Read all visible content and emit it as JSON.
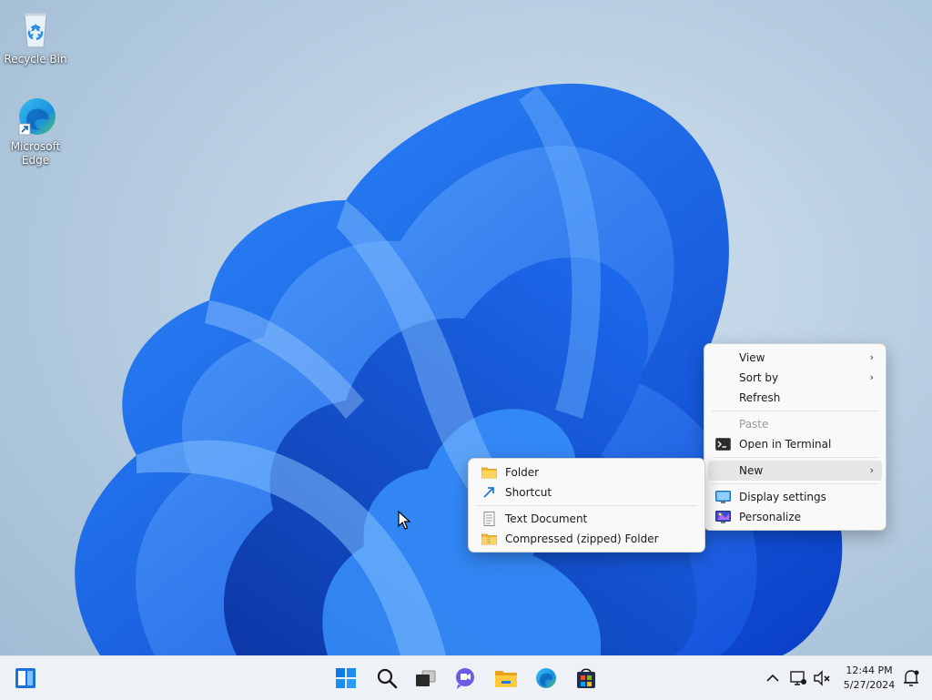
{
  "desktop": {
    "icons": [
      {
        "label": "Recycle Bin",
        "icon": "recycle-bin-icon"
      },
      {
        "label": "Microsoft Edge",
        "icon": "edge-icon"
      }
    ]
  },
  "context_menu": {
    "items": [
      {
        "label": "View",
        "submenu": true
      },
      {
        "label": "Sort by",
        "submenu": true
      },
      {
        "label": "Refresh"
      },
      {
        "label": "Paste",
        "disabled": true
      },
      {
        "label": "Open in Terminal",
        "icon": "terminal-icon"
      },
      {
        "label": "New",
        "submenu": true,
        "highlighted": true
      },
      {
        "label": "Display settings",
        "icon": "display-icon"
      },
      {
        "label": "Personalize",
        "icon": "personalize-icon"
      }
    ],
    "chevron": "›"
  },
  "new_submenu": {
    "items": [
      {
        "label": "Folder",
        "icon": "folder-icon"
      },
      {
        "label": "Shortcut",
        "icon": "shortcut-icon"
      },
      {
        "label": "Text Document",
        "icon": "text-document-icon"
      },
      {
        "label": "Compressed (zipped) Folder",
        "icon": "zip-folder-icon"
      }
    ]
  },
  "taskbar": {
    "widgets_icon": "widgets-icon",
    "pinned": [
      "start-icon",
      "search-icon",
      "task-view-icon",
      "chat-icon",
      "file-explorer-icon",
      "edge-icon",
      "store-icon"
    ],
    "tray": {
      "chevron": "^",
      "time": "12:44 PM",
      "date": "5/27/2024"
    }
  },
  "colors": {
    "accent": "#0078d4",
    "menu_bg": "#f9f9f9",
    "taskbar_bg": "#eef1f5"
  }
}
